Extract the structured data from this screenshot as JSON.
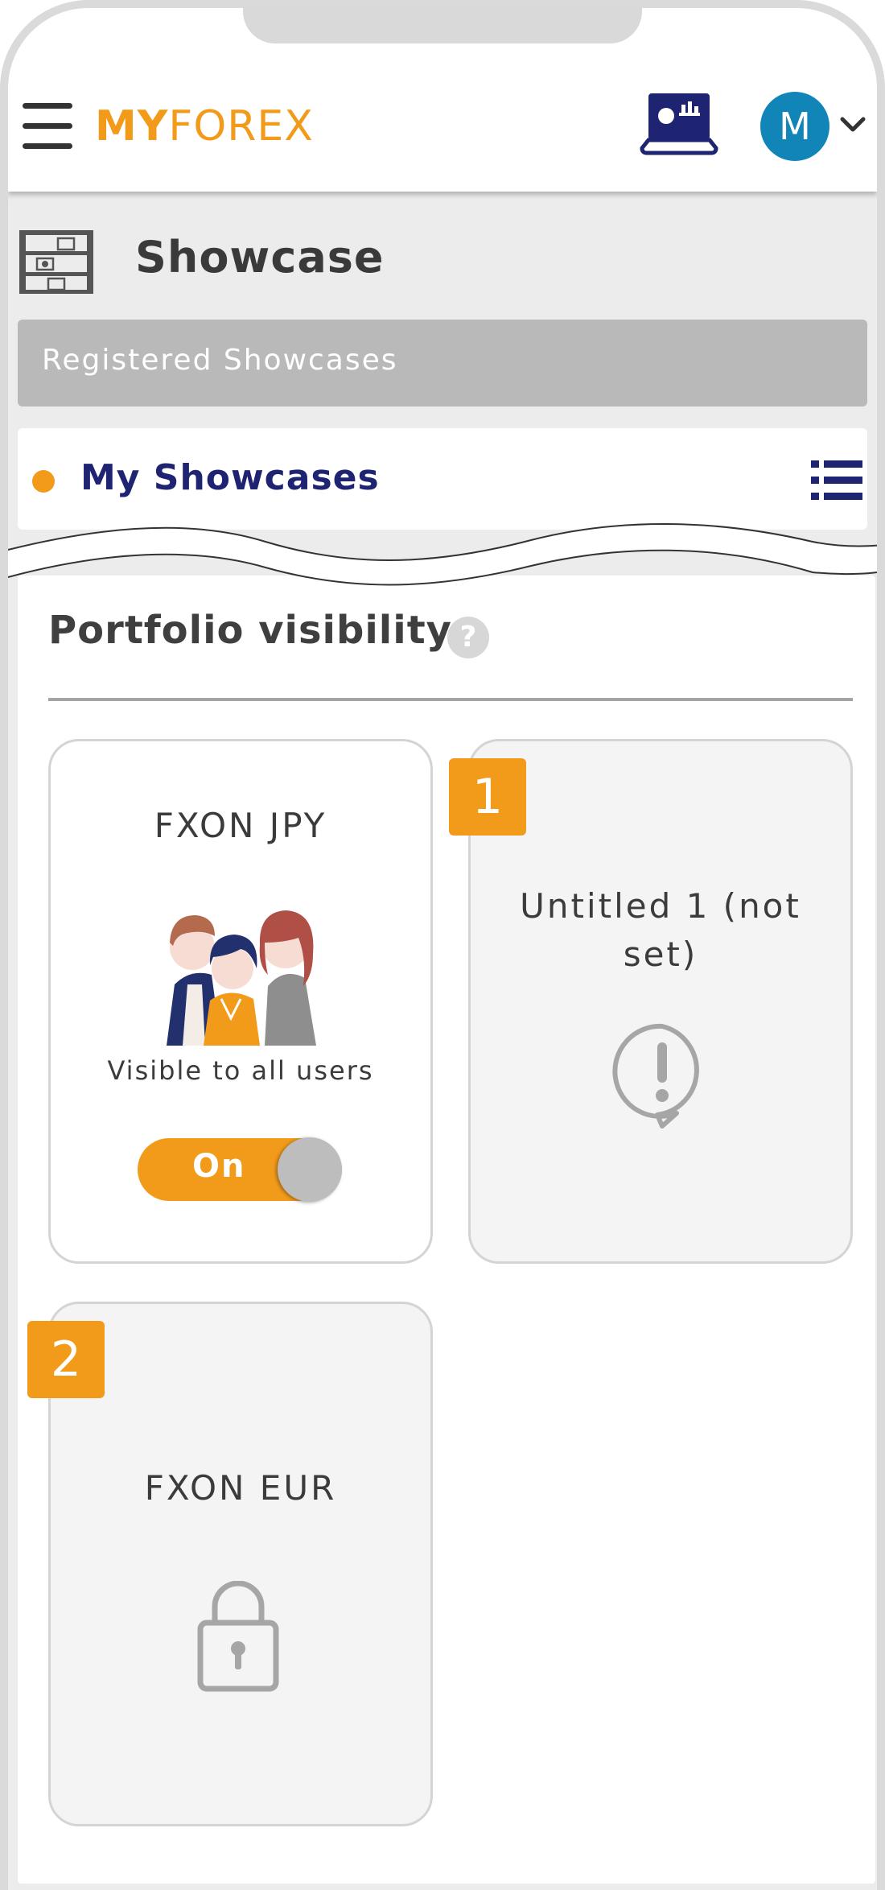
{
  "header": {
    "logo_bold": "MY",
    "logo_thin": "FOREX",
    "avatar_initial": "M"
  },
  "page": {
    "title": "Showcase",
    "registered_label": "Registered Showcases",
    "my_showcases_label": "My Showcases"
  },
  "portfolio": {
    "title": "Portfolio visibility",
    "help": "?",
    "cards": [
      {
        "name": "FXON JPY",
        "status": "Visible to all users",
        "toggle": "On"
      },
      {
        "badge": "1",
        "name_line1": "Untitled 1 (not",
        "name_line2": "set)"
      },
      {
        "badge": "2",
        "name": "FXON EUR"
      }
    ]
  },
  "colors": {
    "accent": "#f29b1b",
    "navy": "#1e2472",
    "avatar": "#1184b8"
  }
}
